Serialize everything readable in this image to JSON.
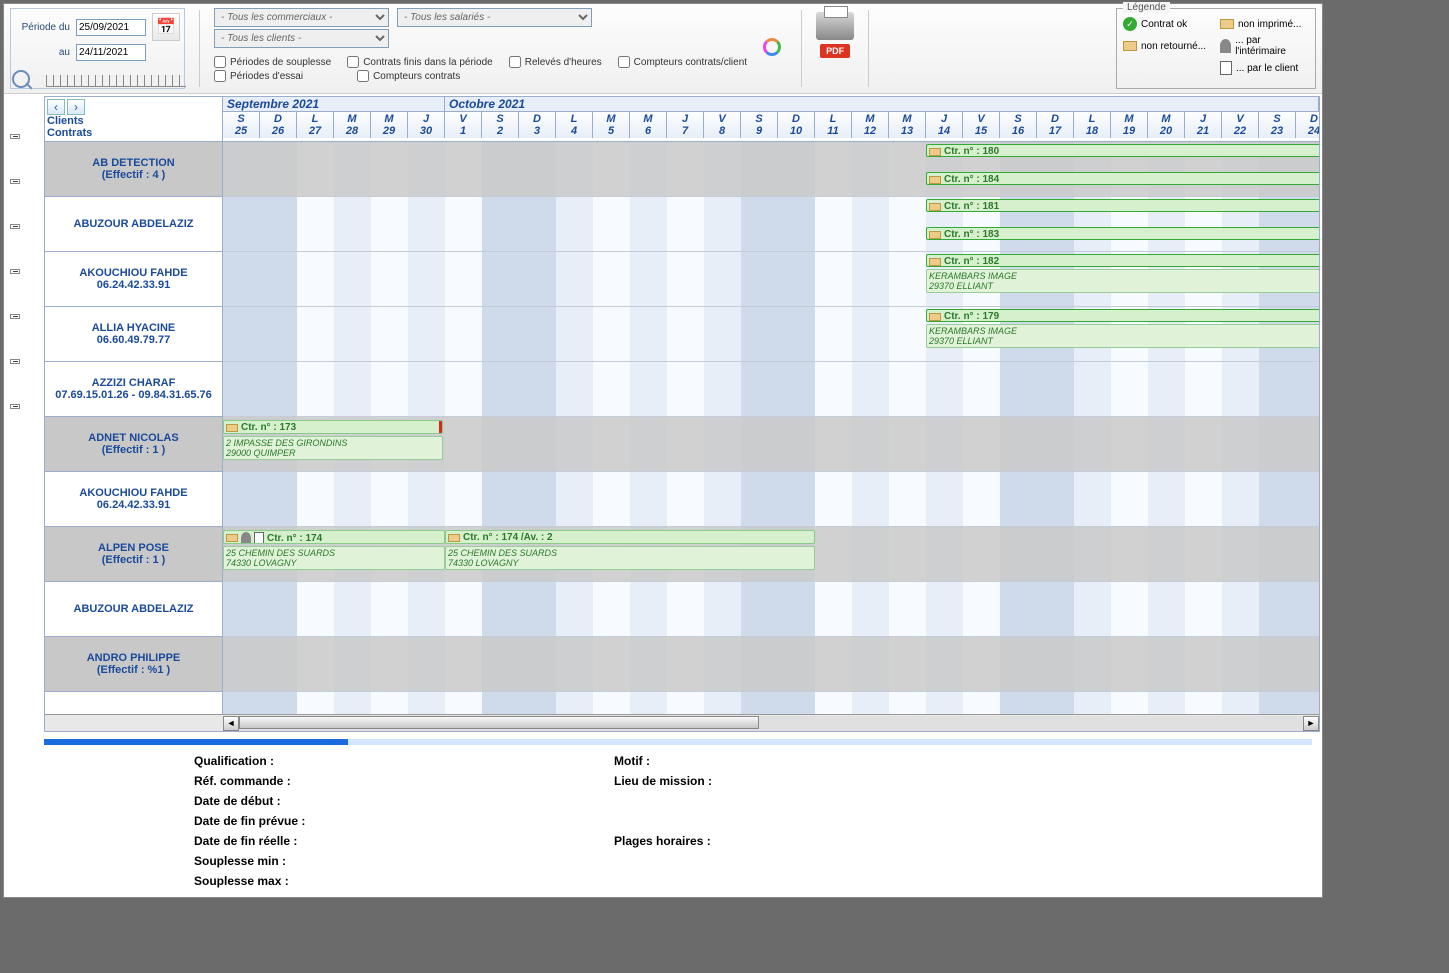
{
  "period": {
    "label_from": "Période du",
    "label_to": "au",
    "date_from": "25/09/2021",
    "date_to": "24/11/2021"
  },
  "dropdowns": {
    "commercials": "- Tous les commerciaux -",
    "clients": "- Tous les clients -",
    "salaries": "- Tous les salariés -"
  },
  "checkboxes": {
    "souplesse": "Périodes de souplesse",
    "essai": "Périodes d'essai",
    "finis": "Contrats finis dans la période",
    "compteurs": "Compteurs contrats",
    "releves": "Relevés d'heures",
    "compteurs_client": "Compteurs contrats/client"
  },
  "pdf_label": "PDF",
  "legend": {
    "title": "Légende",
    "ok": "Contrat ok",
    "non_imprime": "non imprimé...",
    "non_retourne": "non retourné...",
    "par_interimaire": "... par l'intérimaire",
    "par_client": "... par le client"
  },
  "nav": {
    "clients": "Clients",
    "contrats": "Contrats"
  },
  "months": {
    "sep": "Septembre 2021",
    "oct": "Octobre 2021"
  },
  "days": [
    {
      "l": "S",
      "n": "25"
    },
    {
      "l": "D",
      "n": "26"
    },
    {
      "l": "L",
      "n": "27"
    },
    {
      "l": "M",
      "n": "28"
    },
    {
      "l": "M",
      "n": "29"
    },
    {
      "l": "J",
      "n": "30"
    },
    {
      "l": "V",
      "n": "1"
    },
    {
      "l": "S",
      "n": "2"
    },
    {
      "l": "D",
      "n": "3"
    },
    {
      "l": "L",
      "n": "4"
    },
    {
      "l": "M",
      "n": "5"
    },
    {
      "l": "M",
      "n": "6"
    },
    {
      "l": "J",
      "n": "7"
    },
    {
      "l": "V",
      "n": "8"
    },
    {
      "l": "S",
      "n": "9"
    },
    {
      "l": "D",
      "n": "10"
    },
    {
      "l": "L",
      "n": "11"
    },
    {
      "l": "M",
      "n": "12"
    },
    {
      "l": "M",
      "n": "13"
    },
    {
      "l": "J",
      "n": "14"
    },
    {
      "l": "V",
      "n": "15"
    },
    {
      "l": "S",
      "n": "16"
    },
    {
      "l": "D",
      "n": "17"
    },
    {
      "l": "L",
      "n": "18"
    },
    {
      "l": "M",
      "n": "19"
    },
    {
      "l": "M",
      "n": "20"
    },
    {
      "l": "J",
      "n": "21"
    },
    {
      "l": "V",
      "n": "22"
    },
    {
      "l": "S",
      "n": "23"
    },
    {
      "l": "D",
      "n": "24"
    }
  ],
  "rows": [
    {
      "type": "header",
      "name": "AB DETECTION",
      "sub": "(Effectif : 4 )"
    },
    {
      "type": "person",
      "name": "ABUZOUR ABDELAZIZ",
      "sub": ""
    },
    {
      "type": "person",
      "name": "AKOUCHIOU FAHDE",
      "sub": "06.24.42.33.91"
    },
    {
      "type": "person",
      "name": "ALLIA HYACINE",
      "sub": "06.60.49.79.77"
    },
    {
      "type": "person",
      "name": "AZZIZI CHARAF",
      "sub": "07.69.15.01.26 - 09.84.31.65.76"
    },
    {
      "type": "header",
      "name": "ADNET NICOLAS",
      "sub": "(Effectif : 1 )"
    },
    {
      "type": "person",
      "name": "AKOUCHIOU FAHDE",
      "sub": "06.24.42.33.91"
    },
    {
      "type": "header",
      "name": "ALPEN POSE",
      "sub": "(Effectif : 1 )"
    },
    {
      "type": "person",
      "name": "ABUZOUR ABDELAZIZ",
      "sub": ""
    },
    {
      "type": "header",
      "name": "ANDRO PHILIPPE",
      "sub": "(Effectif : %1 )"
    }
  ],
  "bars": {
    "c180": "Ctr. n° : 180",
    "c184": "Ctr. n° : 184",
    "c181": "Ctr. n° : 181",
    "c183": "Ctr. n° : 183",
    "c182": "Ctr. n° : 182",
    "c182_a1": "KERAMBARS IMAGE",
    "c182_a2": "29370 ELLIANT",
    "c179": "Ctr. n° : 179",
    "c179_a1": "KERAMBARS IMAGE",
    "c179_a2": "29370 ELLIANT",
    "c173": "Ctr. n° : 173",
    "c173_a1": "2 IMPASSE DES GIRONDINS",
    "c173_a2": "29000 QUIMPER",
    "c174": "Ctr. n° : 174",
    "c174_a1": "25 CHEMIN DES SUARDS",
    "c174_a2": "74330 LOVAGNY",
    "c174av": "Ctr. n° : 174 /Av. : 2",
    "c174av_a1": "25 CHEMIN DES SUARDS",
    "c174av_a2": "74330 LOVAGNY"
  },
  "details": {
    "qualification": "Qualification :",
    "ref_commande": "Réf. commande :",
    "date_debut": "Date de début :",
    "date_fin_prevue": "Date de fin prévue :",
    "date_fin_reelle": "Date de fin réelle :",
    "souplesse_min": "Souplesse min :",
    "souplesse_max": "Souplesse max :",
    "motif": "Motif :",
    "lieu_mission": "Lieu de mission :",
    "plages": "Plages horaires :"
  }
}
